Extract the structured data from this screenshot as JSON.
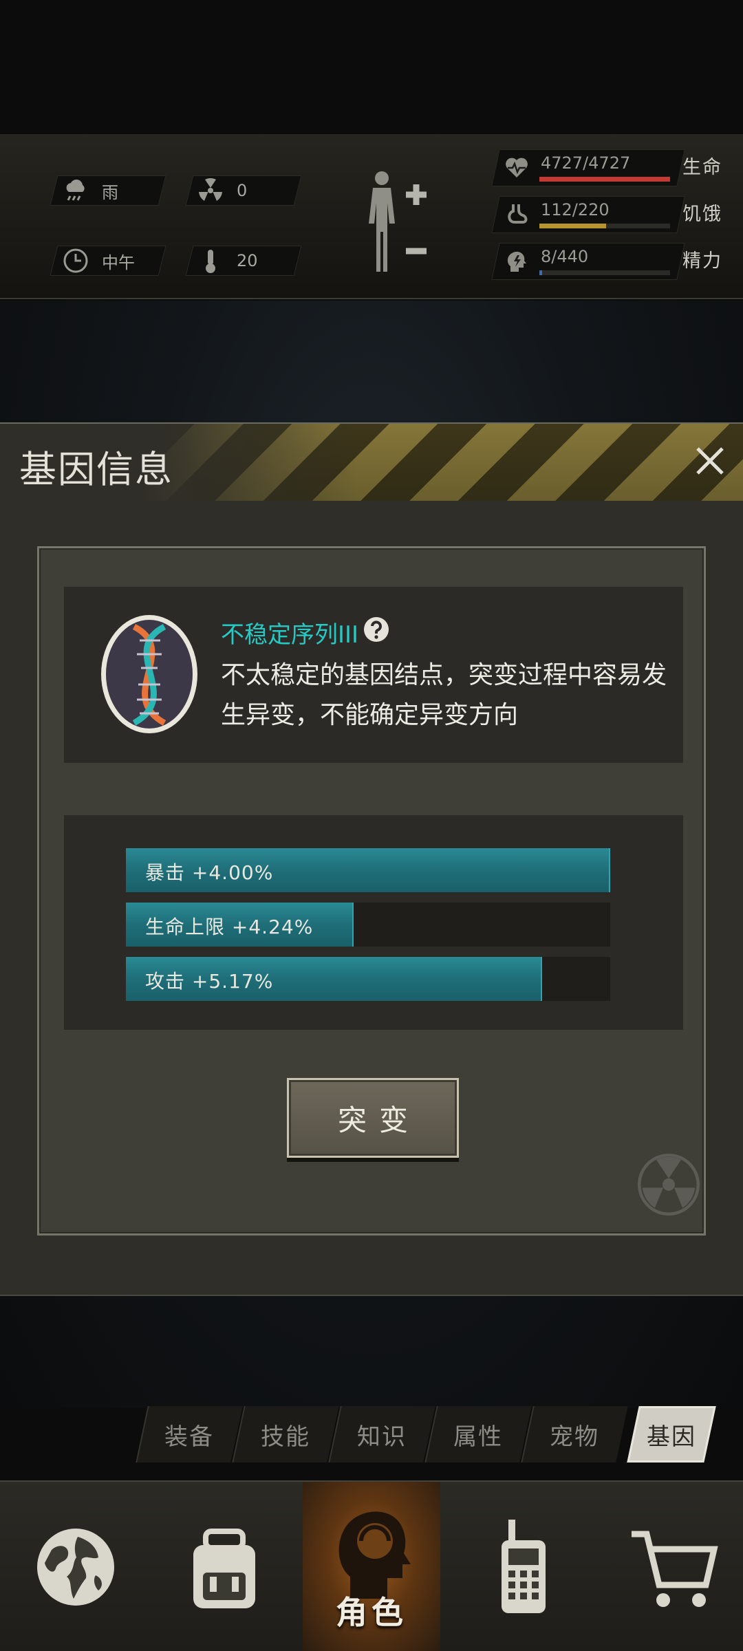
{
  "status": {
    "weather": "雨",
    "radiation": "0",
    "time_of_day": "中午",
    "temperature": "20"
  },
  "vitals": [
    {
      "label": "生命",
      "value": "4727/4727",
      "fill": 1.0,
      "color": "#c23a33",
      "icon": "heart-pulse-icon"
    },
    {
      "label": "饥饿",
      "value": "112/220",
      "fill": 0.51,
      "color": "#b8942e",
      "icon": "stomach-icon"
    },
    {
      "label": "精力",
      "value": "8/440",
      "fill": 0.02,
      "color": "#3f6fa8",
      "icon": "energy-head-icon"
    }
  ],
  "dialog": {
    "title": "基因信息",
    "gene_name": "不稳定序列III",
    "gene_desc": "不太稳定的基因结点，突变过程中容易发生异变，不能确定异变方向",
    "stats": [
      {
        "text": "暴击 +4.00%",
        "fill": 1.0
      },
      {
        "text": "生命上限 +4.24%",
        "fill": 0.47
      },
      {
        "text": "攻击 +5.17%",
        "fill": 0.86
      }
    ],
    "mutate_label": "突变"
  },
  "tabs": [
    {
      "label": "装备",
      "active": false
    },
    {
      "label": "技能",
      "active": false
    },
    {
      "label": "知识",
      "active": false
    },
    {
      "label": "属性",
      "active": false
    },
    {
      "label": "宠物",
      "active": false
    },
    {
      "label": "基因",
      "active": true
    }
  ],
  "bottom_nav": {
    "active_label": "角色",
    "items": [
      "globe-map-icon",
      "backpack-icon",
      "character-head-icon",
      "radio-icon",
      "cart-icon"
    ]
  },
  "colors": {
    "accent_teal": "#27c9c4",
    "bar_teal": "#1f6e78",
    "active_nav": "#9b5a1a"
  }
}
